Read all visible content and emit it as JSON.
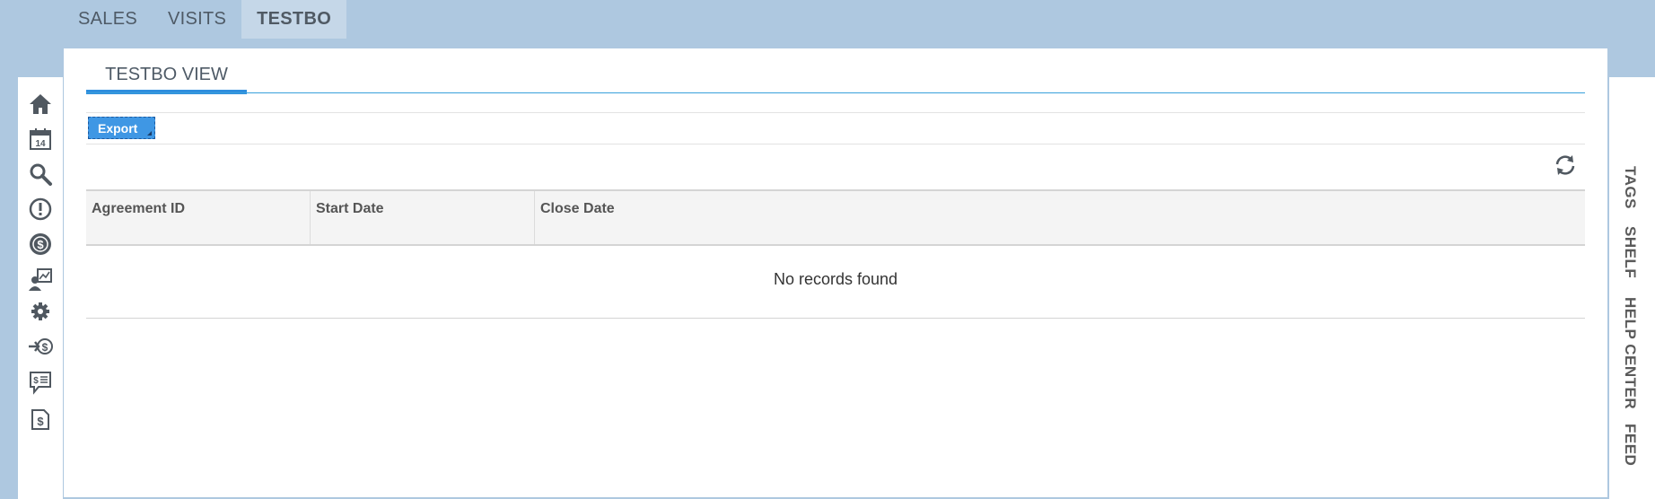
{
  "top_tabs": [
    {
      "label": "SALES",
      "active": false
    },
    {
      "label": "VISITS",
      "active": false
    },
    {
      "label": "TESTBO",
      "active": true
    }
  ],
  "left_nav": [
    {
      "icon": "home-icon"
    },
    {
      "icon": "calendar-icon",
      "text": "14"
    },
    {
      "icon": "search-icon"
    },
    {
      "icon": "alert-icon"
    },
    {
      "icon": "dollar-circle-icon"
    },
    {
      "icon": "user-chart-icon"
    },
    {
      "icon": "gear-icon"
    },
    {
      "icon": "arrow-dollar-icon"
    },
    {
      "icon": "dollar-message-icon"
    },
    {
      "icon": "dollar-document-icon"
    }
  ],
  "view": {
    "tab_label": "TESTBO VIEW",
    "export_label": "Export",
    "refresh_icon": "refresh-icon"
  },
  "grid": {
    "columns": [
      "Agreement ID",
      "Start Date",
      "Close Date"
    ],
    "empty_message": "No records found"
  },
  "right_bar": [
    "TAGS",
    "SHELF",
    "HELP CENTER",
    "FEED"
  ],
  "colors": {
    "background": "#aec8e0",
    "accent": "#2f8ede",
    "export_button": "#3f97e4"
  }
}
